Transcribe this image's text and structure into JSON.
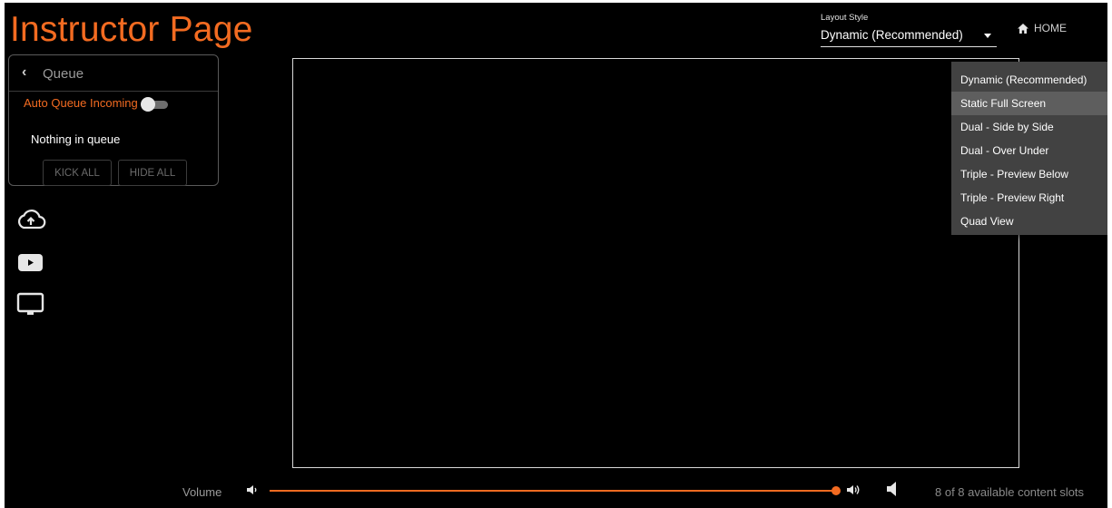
{
  "page": {
    "title": "Instructor Page"
  },
  "queue": {
    "title": "Queue",
    "auto_queue_label": "Auto Queue Incoming",
    "auto_queue_enabled": false,
    "empty_text": "Nothing in queue",
    "kick_all_label": "KICK ALL",
    "hide_all_label": "HIDE ALL"
  },
  "side_icons": [
    "cloud-upload-icon",
    "youtube-icon",
    "monitor-icon"
  ],
  "layout_style": {
    "label": "Layout Style",
    "value": "Dynamic (Recommended)",
    "options": [
      "Dynamic (Recommended)",
      "Static Full Screen",
      "Dual - Side by Side",
      "Dual - Over Under",
      "Triple - Preview Below",
      "Triple - Preview Right",
      "Quad View"
    ],
    "highlighted_option": "Static Full Screen"
  },
  "home": {
    "label": "HOME"
  },
  "volume": {
    "label": "Volume",
    "level": 1.0
  },
  "slots": {
    "text": "8 of 8 available content slots"
  },
  "colors": {
    "accent": "#f36b21",
    "background": "#000000",
    "menu_bg": "#424242"
  }
}
